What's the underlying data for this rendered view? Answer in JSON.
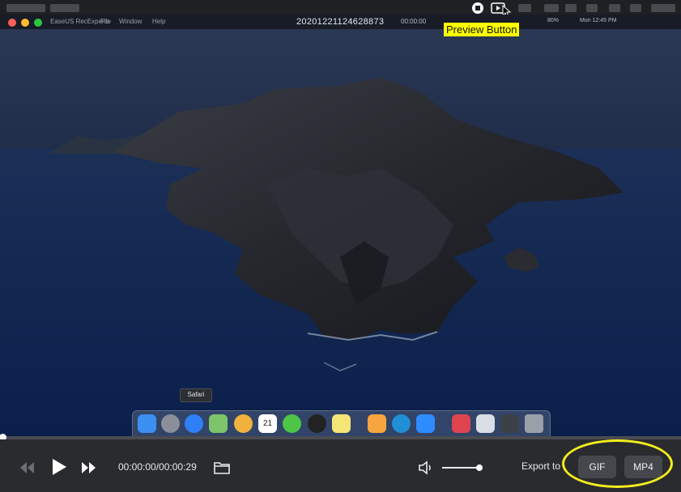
{
  "host_menubar": {
    "clock": "Mon 12:45 PM",
    "battery": "80%"
  },
  "guest_menubar": {
    "app_name": "EaseUS RecExperts",
    "menus": [
      "File",
      "Window",
      "Help"
    ],
    "recording_title": "20201221124628873",
    "timer": "00:00:00"
  },
  "callout": {
    "text": "Preview Button"
  },
  "dock": {
    "tooltip": "Safari",
    "apps": [
      "finder-icon",
      "launchpad-icon",
      "safari-icon",
      "maps-icon",
      "photos-icon",
      "calendar-icon",
      "wechat-icon",
      "qq-icon",
      "notes-icon",
      "pages-icon",
      "edge-icon",
      "zoom-icon",
      "recexperts-icon",
      "screenshot-icon",
      "recorder-icon",
      "trash-icon"
    ],
    "calendar_day": "21"
  },
  "player": {
    "time": "00:00:00/00:00:29",
    "progress": 0.0,
    "volume": 1.0,
    "export_label": "Export to",
    "formats": [
      "GIF",
      "MP4"
    ]
  },
  "colors": {
    "callout_bg": "#ffff00",
    "highlight": "#f4ee1c",
    "controls_bg": "#2a2b2f",
    "button_bg": "#45474d"
  }
}
